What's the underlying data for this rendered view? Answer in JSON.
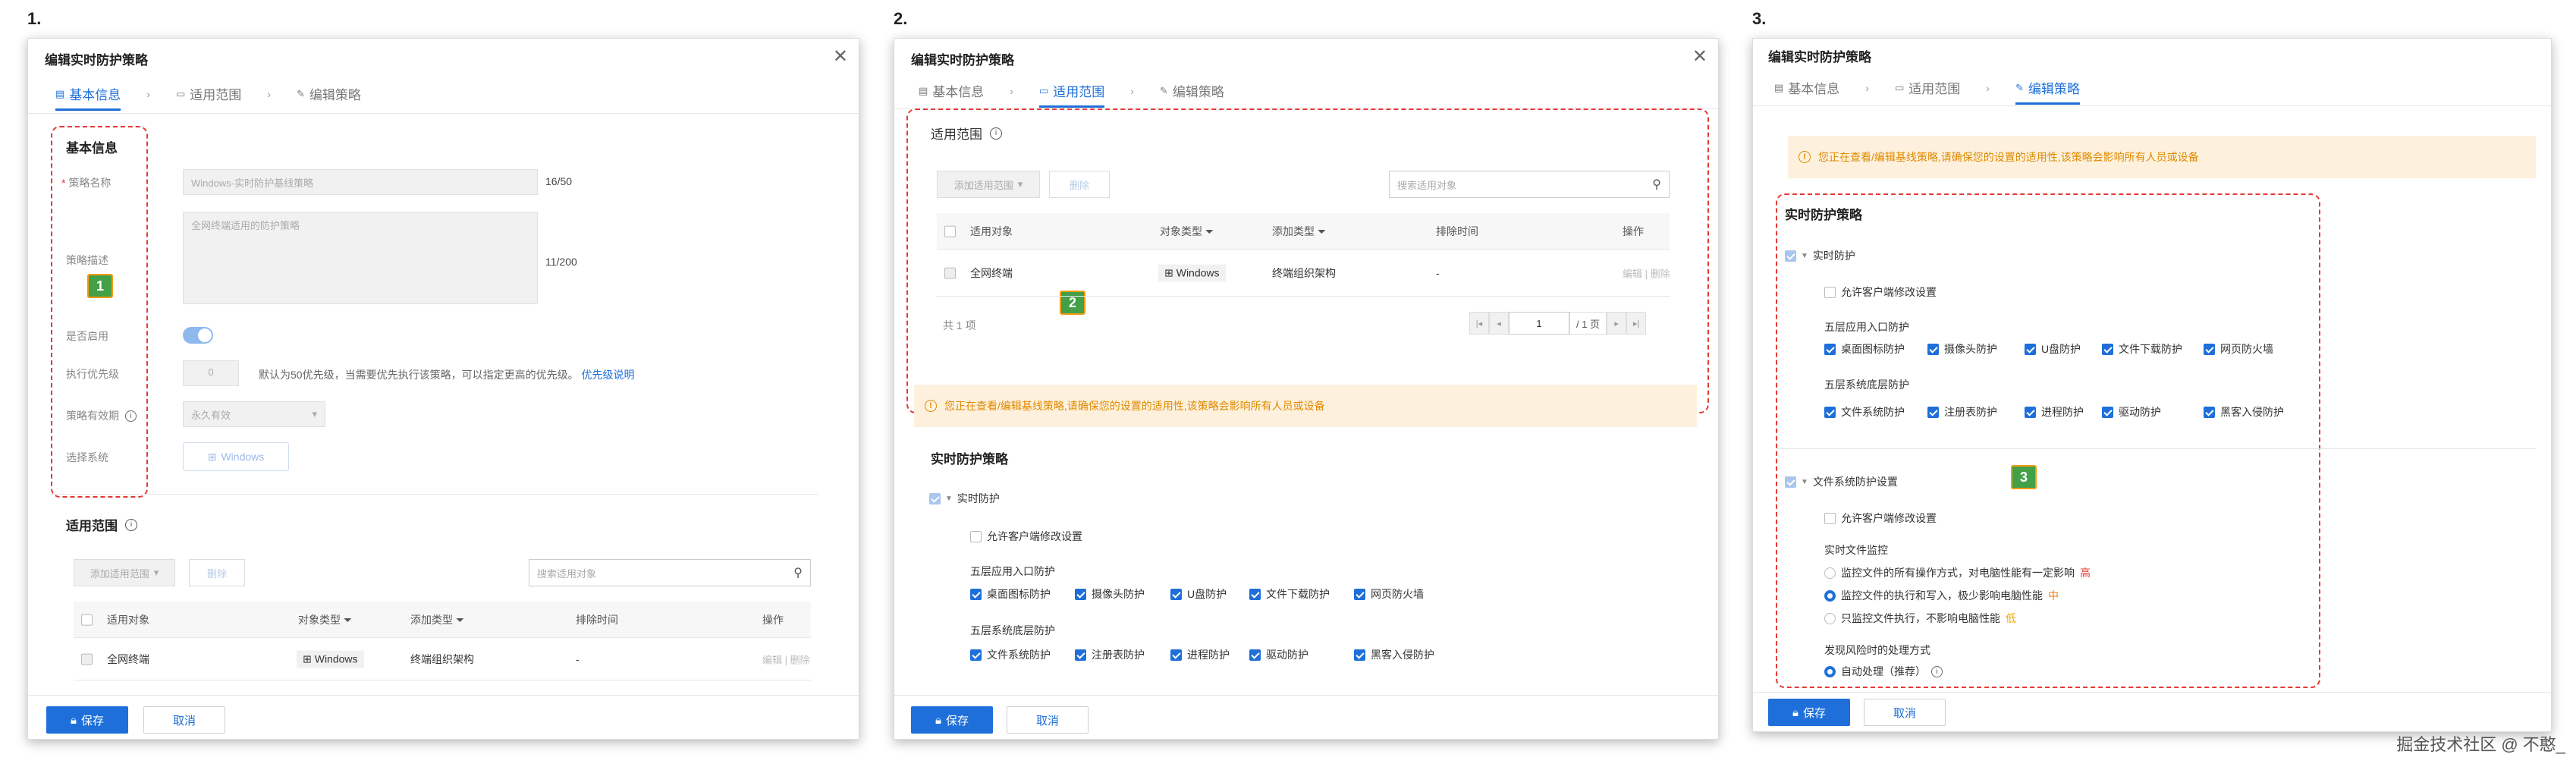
{
  "panels": [
    {
      "step": "1.",
      "title": "编辑实时防护策略",
      "badge": "1",
      "tabs": {
        "basic": "基本信息",
        "scope": "适用范围",
        "policy": "编辑策略"
      },
      "basic": {
        "section": "基本信息",
        "name_label": "策略名称",
        "name_value": "Windows-实时防护基线策略",
        "name_counter": "16/50",
        "desc_label": "策略描述",
        "desc_value": "全网终端适用的防护策略",
        "desc_counter": "11/200",
        "enable_label": "是否启用",
        "enabled": true,
        "priority_label": "执行优先级",
        "priority_value": "0",
        "priority_hint": "默认为50优先级，当需要优先执行该策略，可以指定更高的优先级。",
        "priority_link": "优先级说明",
        "validity_label": "策略有效期",
        "validity_value": "永久有效",
        "os_label": "选择系统",
        "os_value": "Windows"
      },
      "scope_title": "适用范围",
      "add_scope": "添加适用范围",
      "delete": "删除",
      "search_placeholder": "搜索适用对象",
      "table": {
        "headers": [
          "适用对象",
          "对象类型",
          "添加类型",
          "排除时间",
          "操作"
        ],
        "rows": [
          {
            "target": "全网终端",
            "type": "Windows",
            "add_type": "终端组织架构",
            "exclude": "-",
            "edit": "编辑",
            "del": "删除"
          }
        ]
      },
      "save": "保存",
      "cancel": "取消"
    },
    {
      "step": "2.",
      "title": "编辑实时防护策略",
      "badge": "2",
      "tabs": {
        "basic": "基本信息",
        "scope": "适用范围",
        "policy": "编辑策略"
      },
      "scope_title": "适用范围",
      "add_scope": "添加适用范围",
      "delete": "删除",
      "search_placeholder": "搜索适用对象",
      "table": {
        "headers": [
          "适用对象",
          "对象类型",
          "添加类型",
          "排除时间",
          "操作"
        ],
        "rows": [
          {
            "target": "全网终端",
            "type": "Windows",
            "add_type": "终端组织架构",
            "exclude": "-",
            "edit": "编辑",
            "del": "删除"
          }
        ]
      },
      "total": "共 1 项",
      "page": "1",
      "pages": "/ 1 页",
      "warning": "您正在查看/编辑基线策略,请确保您的设置的适用性,该策略会影响所有人员或设备",
      "policy_title": "实时防护策略",
      "rt_group": "实时防护",
      "allow_client": "允许客户端修改设置",
      "entry_title": "五层应用入口防护",
      "entry_items": [
        "桌面图标防护",
        "摄像头防护",
        "U盘防护",
        "文件下载防护",
        "网页防火墙"
      ],
      "base_title": "五层系统底层防护",
      "base_items": [
        "文件系统防护",
        "注册表防护",
        "进程防护",
        "驱动防护",
        "黑客入侵防护"
      ],
      "save": "保存",
      "cancel": "取消"
    },
    {
      "step": "3.",
      "title": "编辑实时防护策略",
      "badge": "3",
      "tabs": {
        "basic": "基本信息",
        "scope": "适用范围",
        "policy": "编辑策略"
      },
      "warning": "您正在查看/编辑基线策略,请确保您的设置的适用性,该策略会影响所有人员或设备",
      "policy_title": "实时防护策略",
      "rt_group": "实时防护",
      "allow_client": "允许客户端修改设置",
      "entry_title": "五层应用入口防护",
      "entry_items": [
        "桌面图标防护",
        "摄像头防护",
        "U盘防护",
        "文件下载防护",
        "网页防火墙"
      ],
      "base_title": "五层系统底层防护",
      "base_items": [
        "文件系统防护",
        "注册表防护",
        "进程防护",
        "驱动防护",
        "黑客入侵防护"
      ],
      "fs_group": "文件系统防护设置",
      "fs_allow_client": "允许客户端修改设置",
      "monitor_title": "实时文件监控",
      "monitor_options": [
        {
          "text": "监控文件的所有操作方式，对电脑性能有一定影响",
          "level": "高",
          "selected": false
        },
        {
          "text": "监控文件的执行和写入，极少影响电脑性能",
          "level": "中",
          "selected": true
        },
        {
          "text": "只监控文件执行，不影响电脑性能",
          "level": "低",
          "selected": false
        }
      ],
      "risk_title": "发现风险时的处理方式",
      "risk_option": "自动处理（推荐）",
      "save": "保存",
      "cancel": "取消"
    }
  ],
  "watermark": "掘金技术社区 @ 不憨_"
}
